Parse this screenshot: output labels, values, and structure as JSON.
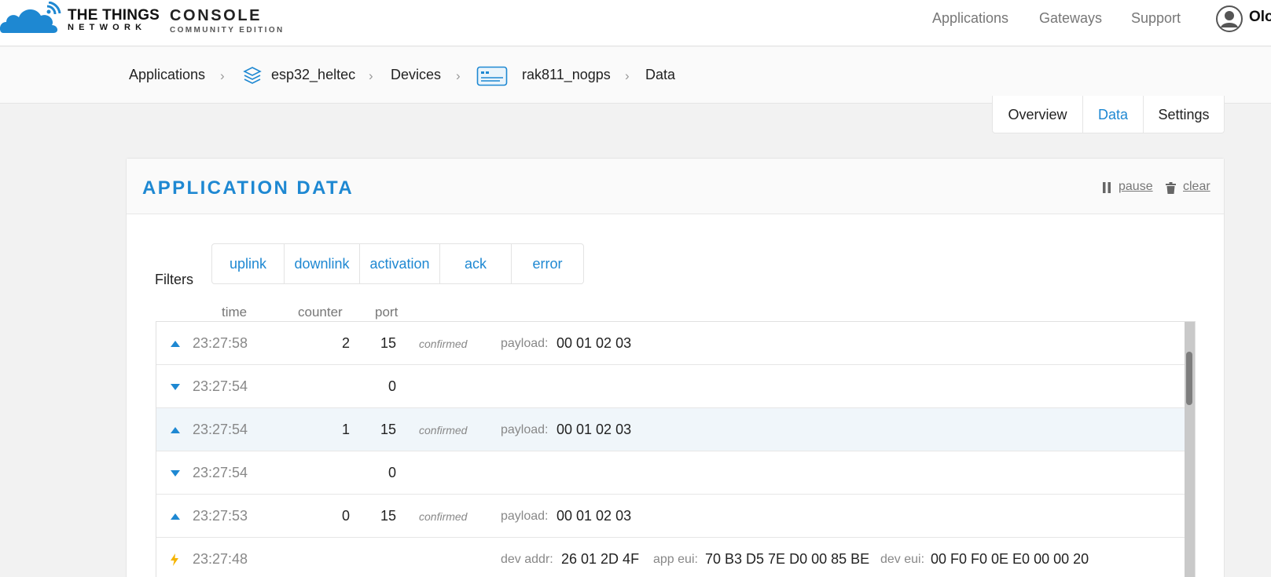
{
  "header": {
    "logo": {
      "line1": "THE THINGS",
      "line2": "NETWORK",
      "product": "CONSOLE",
      "edition": "COMMUNITY EDITION"
    },
    "nav": [
      "Applications",
      "Gateways",
      "Support"
    ],
    "user": {
      "name": "Olo",
      "icon": "user-avatar-icon"
    }
  },
  "breadcrumb": {
    "items": [
      "Applications",
      "esp32_heltec",
      "Devices",
      "rak811_nogps",
      "Data"
    ],
    "separator": "›",
    "icons": {
      "application": "layers-icon",
      "device": "device-icon"
    }
  },
  "tabs": {
    "items": [
      "Overview",
      "Data",
      "Settings"
    ],
    "active": "Data"
  },
  "panel": {
    "title": "APPLICATION DATA",
    "pause_label": "pause",
    "clear_label": "clear",
    "filters_label": "Filters",
    "filters": [
      "uplink",
      "downlink",
      "activation",
      "ack",
      "error"
    ],
    "columns": {
      "time": "time",
      "counter": "counter",
      "port": "port"
    },
    "rows": [
      {
        "direction": "up",
        "time": "23:27:58",
        "counter": "2",
        "port": "15",
        "confirmed": "confirmed",
        "payload_label": "payload:",
        "payload": "00 01 02 03"
      },
      {
        "direction": "down",
        "time": "23:27:54",
        "counter": "",
        "port": "0"
      },
      {
        "direction": "up",
        "time": "23:27:54",
        "counter": "1",
        "port": "15",
        "confirmed": "confirmed",
        "payload_label": "payload:",
        "payload": "00 01 02 03",
        "highlighted": true
      },
      {
        "direction": "down",
        "time": "23:27:54",
        "counter": "",
        "port": "0"
      },
      {
        "direction": "up",
        "time": "23:27:53",
        "counter": "0",
        "port": "15",
        "confirmed": "confirmed",
        "payload_label": "payload:",
        "payload": "00 01 02 03"
      },
      {
        "direction": "activation",
        "time": "23:27:48",
        "dev_addr_label": "dev addr:",
        "dev_addr": "26 01 2D 4F",
        "app_eui_label": "app eui:",
        "app_eui": "70 B3 D5 7E D0 00 85 BE",
        "dev_eui_label": "dev eui:",
        "dev_eui": "00 F0 F0 0E E0 00 00 20"
      }
    ]
  },
  "colors": {
    "accent": "#1e88d2",
    "activation": "#f5b400"
  }
}
